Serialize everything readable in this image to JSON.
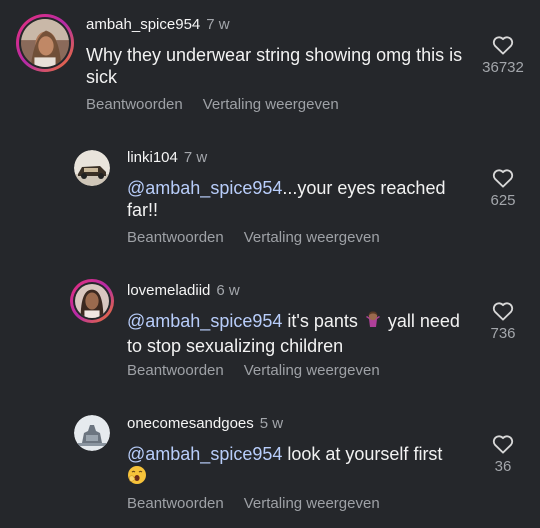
{
  "comments": [
    {
      "username": "ambah_spice954",
      "time": "7 w",
      "mention": "",
      "text": "Why they underwear string showing omg this is sick",
      "likes": "36732",
      "reply_label": "Beantwoorden",
      "translate_label": "Vertaling weergeven"
    },
    {
      "username": "linki104",
      "time": "7 w",
      "mention": "@ambah_spice954",
      "text": "...your eyes reached far!!",
      "likes": "625",
      "reply_label": "Beantwoorden",
      "translate_label": "Vertaling weergeven"
    },
    {
      "username": "lovemeladiid",
      "time": "6 w",
      "mention": "@ambah_spice954",
      "text_before": " it's pants ",
      "emoji": "woman-shrugging",
      "text_after": " yall need to stop sexualizing children",
      "likes": "736",
      "reply_label": "Beantwoorden",
      "translate_label": "Vertaling weergeven"
    },
    {
      "username": "onecomesandgoes",
      "time": "5 w",
      "mention": "@ambah_spice954",
      "text": " look at yourself first",
      "emoji": "yawning-face",
      "likes": "36",
      "reply_label": "Beantwoorden",
      "translate_label": "Vertaling weergeven"
    }
  ],
  "colors": {
    "background": "#25272b",
    "mention": "#b8cdfa",
    "secondary_text": "#9ea1a6",
    "story_ring": "#d62f8c"
  }
}
